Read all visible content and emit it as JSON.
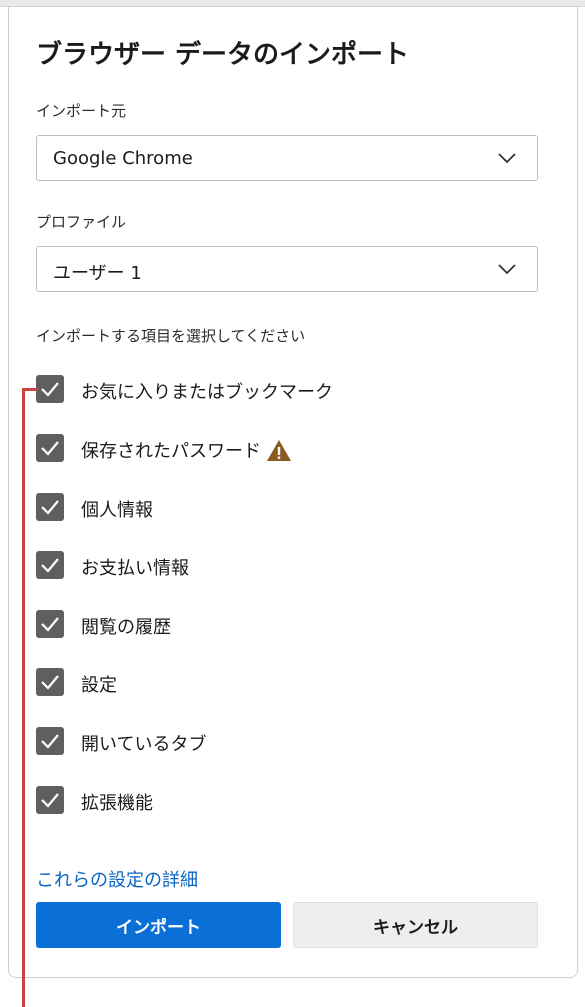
{
  "dialog": {
    "title": "ブラウザー データのインポート",
    "source": {
      "label": "インポート元",
      "value": "Google Chrome"
    },
    "profile": {
      "label": "プロファイル",
      "value": "ユーザー 1"
    },
    "section_label": "インポートする項目を選択してください",
    "items": [
      {
        "label": "お気に入りまたはブックマーク",
        "checked": true
      },
      {
        "label": "保存されたパスワード",
        "checked": true,
        "warning": true
      },
      {
        "label": "個人情報",
        "checked": true
      },
      {
        "label": "お支払い情報",
        "checked": true
      },
      {
        "label": "閲覧の履歴",
        "checked": true
      },
      {
        "label": "設定",
        "checked": true
      },
      {
        "label": "開いているタブ",
        "checked": true
      },
      {
        "label": "拡張機能",
        "checked": true
      }
    ],
    "details_link": "これらの設定の詳細",
    "import_button": "インポート",
    "cancel_button": "キャンセル"
  },
  "icons": {
    "checkbox": "checkmark-icon",
    "dropdown": "chevron-down-icon",
    "warning": "warning-icon"
  },
  "colors": {
    "accent": "#0a6fd6",
    "link": "#0a66c2",
    "checkbox": "#5f5f5f",
    "warning": "#8a5a1e",
    "callout": "#c8463e"
  }
}
